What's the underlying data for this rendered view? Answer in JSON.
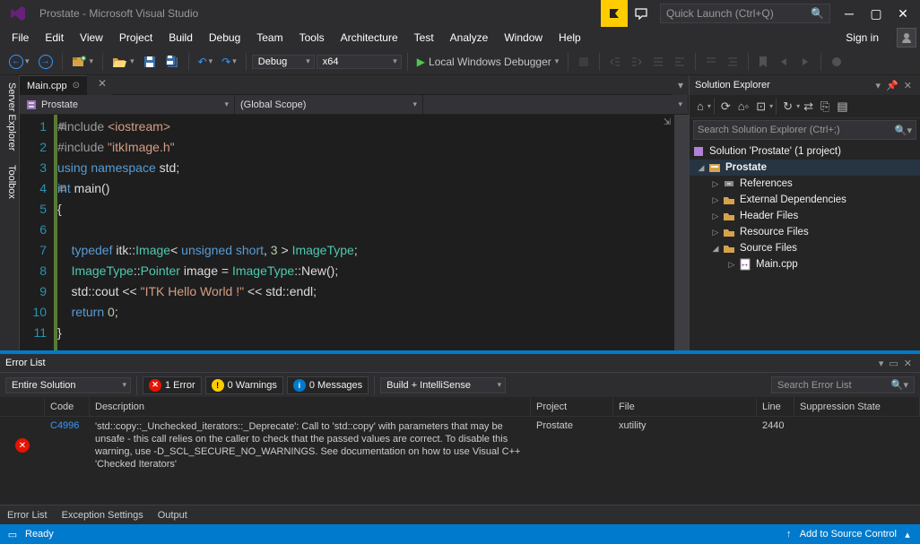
{
  "title": "Prostate - Microsoft Visual Studio",
  "quick_launch_placeholder": "Quick Launch (Ctrl+Q)",
  "menu": [
    "File",
    "Edit",
    "View",
    "Project",
    "Build",
    "Debug",
    "Team",
    "Tools",
    "Architecture",
    "Test",
    "Analyze",
    "Window",
    "Help"
  ],
  "signin": "Sign in",
  "toolbar": {
    "config": "Debug",
    "platform": "x64",
    "debugger": "Local Windows Debugger"
  },
  "vtabs": [
    "Server Explorer",
    "Toolbox"
  ],
  "editor": {
    "tab_name": "Main.cpp",
    "scope_dd_left": "Prostate",
    "scope_dd_mid": "(Global Scope)",
    "line_count": 11
  },
  "code": {
    "lines": [
      {
        "n": 1,
        "html": "<span class='dir'>#include</span> <span class='str'>&lt;iostream&gt;</span>"
      },
      {
        "n": 2,
        "html": "<span class='dir'>#include</span> <span class='str'>\"itkImage.h\"</span>"
      },
      {
        "n": 3,
        "html": "<span class='kw'>using</span> <span class='kw'>namespace</span> std;"
      },
      {
        "n": 4,
        "html": "<span class='kw'>int</span> main()"
      },
      {
        "n": 5,
        "html": "{"
      },
      {
        "n": 6,
        "html": ""
      },
      {
        "n": 7,
        "html": "    <span class='kw'>typedef</span> itk::<span class='type'>Image</span>&lt; <span class='kw'>unsigned</span> <span class='kw'>short</span>, <span class='num'>3</span> &gt; <span class='type'>ImageType</span>;"
      },
      {
        "n": 8,
        "html": "    <span class='type'>ImageType</span>::<span class='type'>Pointer</span> image = <span class='type'>ImageType</span>::New();"
      },
      {
        "n": 9,
        "html": "    std::cout &lt;&lt; <span class='str'>\"ITK Hello World !\"</span> &lt;&lt; std::endl;"
      },
      {
        "n": 10,
        "html": "    <span class='kw'>return</span> <span class='num'>0</span>;"
      },
      {
        "n": 11,
        "html": "}"
      }
    ]
  },
  "solution_explorer": {
    "title": "Solution Explorer",
    "search_placeholder": "Search Solution Explorer (Ctrl+;)",
    "root": "Solution 'Prostate' (1 project)",
    "project": "Prostate",
    "nodes": [
      "References",
      "External Dependencies",
      "Header Files",
      "Resource Files",
      "Source Files"
    ],
    "source_file": "Main.cpp"
  },
  "error_list": {
    "title": "Error List",
    "scope": "Entire Solution",
    "counts": {
      "errors": "1 Error",
      "warnings": "0 Warnings",
      "messages": "0 Messages"
    },
    "build_filter": "Build + IntelliSense",
    "search_placeholder": "Search Error List",
    "columns": [
      "",
      "Code",
      "Description",
      "Project",
      "File",
      "Line",
      "Suppression State"
    ],
    "rows": [
      {
        "code": "C4996",
        "description": "'std::copy::_Unchecked_iterators::_Deprecate': Call to 'std::copy' with parameters that may be unsafe - this call relies on the caller to check that the passed values are correct. To disable this warning, use -D_SCL_SECURE_NO_WARNINGS. See documentation on how to use Visual C++ 'Checked Iterators'",
        "project": "Prostate",
        "file": "xutility",
        "line": "2440",
        "suppression": ""
      }
    ]
  },
  "bottom_tabs": [
    "Error List",
    "Exception Settings",
    "Output"
  ],
  "status": {
    "left": "Ready",
    "source_control": "Add to Source Control"
  }
}
